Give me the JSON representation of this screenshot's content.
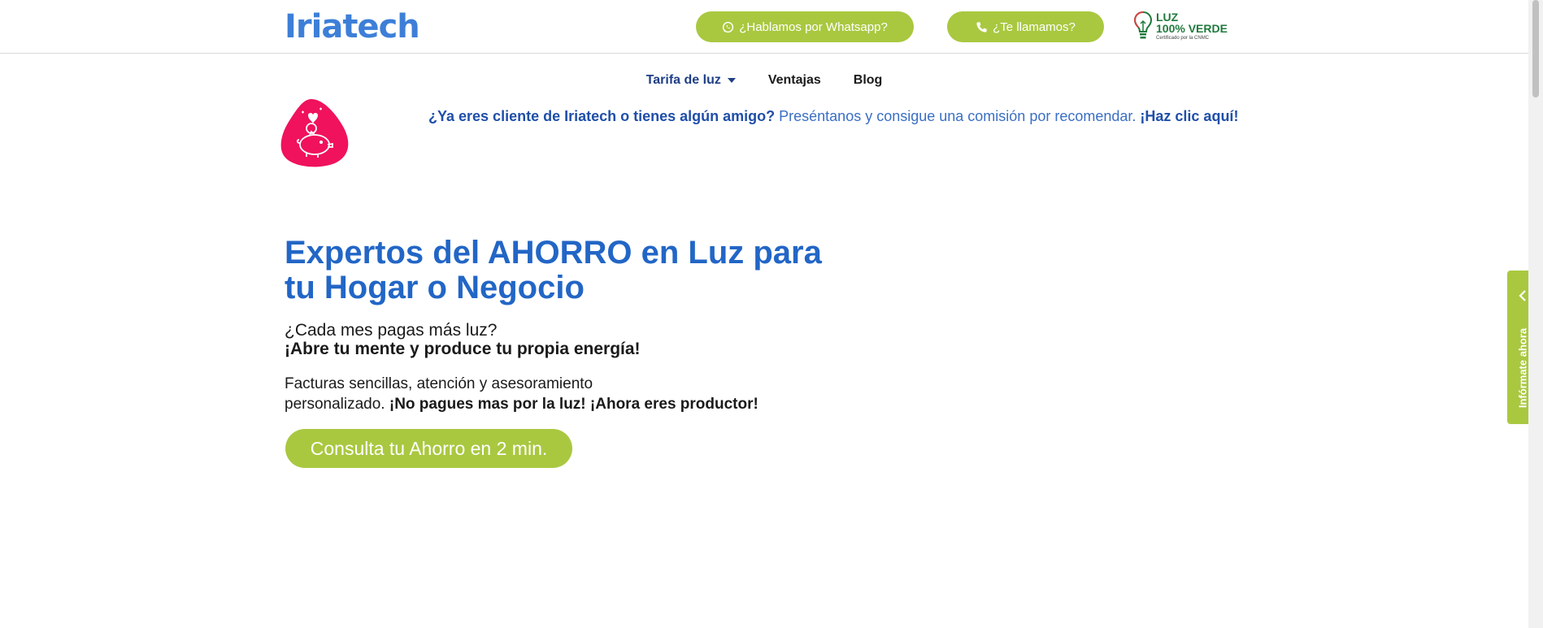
{
  "header": {
    "logo": "Iriatech",
    "whatsapp_label": "¿Hablamos por Whatsapp?",
    "call_label": "¿Te llamamos?",
    "badge": {
      "line1": "LUZ",
      "line2": "100% VERDE",
      "line3": "Certificado por la CNMC"
    }
  },
  "nav": {
    "items": [
      {
        "label": "Tarifa de luz"
      },
      {
        "label": "Ventajas"
      },
      {
        "label": "Blog"
      }
    ]
  },
  "referral": {
    "question": "¿Ya eres cliente de Iriatech o tienes algún amigo?",
    "text": " Preséntanos y consigue una comisión por recomendar. ",
    "link": "¡Haz clic aquí!"
  },
  "hero": {
    "title_line1": "Expertos del AHORRO en Luz para",
    "title_line2": "tu Hogar o Negocio",
    "question": "¿Cada mes pagas más luz?",
    "strong": "¡Abre tu mente y produce tu propia energía!",
    "desc_line1": "Facturas sencillas, atención y asesoramiento",
    "desc_line2_plain": "personalizado. ",
    "desc_line2_bold": "¡No pagues mas por la luz! ¡Ahora eres productor!",
    "cta": "Consulta tu Ahorro en 2 min."
  },
  "side_tab": {
    "label": "Infórmate ahora"
  },
  "colors": {
    "brand_blue": "#2266c6",
    "green": "#a9c840",
    "pink": "#f0125c",
    "nav_active": "#1f3f86"
  },
  "icons": [
    "whatsapp-icon",
    "phone-icon",
    "bulb-icon",
    "piggy-bank-icon",
    "chevron-left-icon",
    "caret-down-icon"
  ]
}
